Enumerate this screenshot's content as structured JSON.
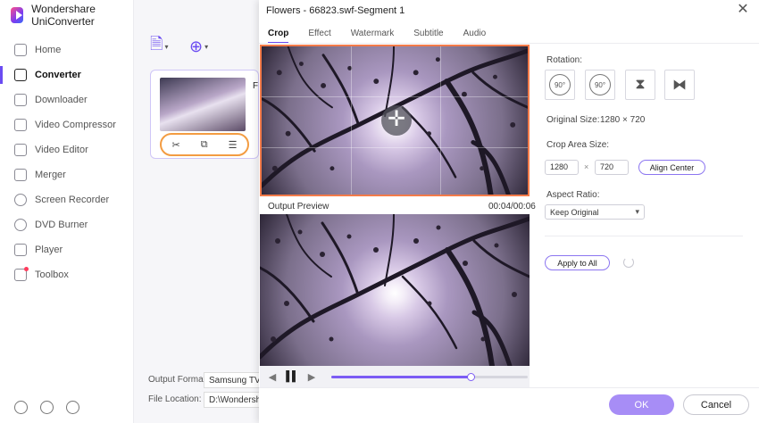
{
  "app": {
    "name": "Wondershare UniConverter"
  },
  "sidebar": {
    "items": [
      {
        "label": "Home",
        "icon": "home-icon",
        "active": false
      },
      {
        "label": "Converter",
        "icon": "converter-icon",
        "active": true
      },
      {
        "label": "Downloader",
        "icon": "downloader-icon",
        "active": false
      },
      {
        "label": "Video Compressor",
        "icon": "compress-icon",
        "active": false
      },
      {
        "label": "Video Editor",
        "icon": "video-editor-icon",
        "active": false
      },
      {
        "label": "Merger",
        "icon": "merger-icon",
        "active": false
      },
      {
        "label": "Screen Recorder",
        "icon": "screen-recorder-icon",
        "active": false
      },
      {
        "label": "DVD Burner",
        "icon": "dvd-icon",
        "active": false
      },
      {
        "label": "Player",
        "icon": "player-icon",
        "active": false
      },
      {
        "label": "Toolbox",
        "icon": "toolbox-icon",
        "active": false
      }
    ]
  },
  "converter": {
    "output_format_label": "Output Format:",
    "output_format_value": "Samsung TV",
    "file_location_label": "File Location:",
    "file_location_value": "D:\\Wondershare",
    "file_name_partial": "F"
  },
  "dialog": {
    "title": "Flowers - 66823.swf-Segment 1",
    "tabs": [
      {
        "label": "Crop",
        "active": true
      },
      {
        "label": "Effect",
        "active": false
      },
      {
        "label": "Watermark",
        "active": false
      },
      {
        "label": "Subtitle",
        "active": false
      },
      {
        "label": "Audio",
        "active": false
      }
    ],
    "preview": {
      "label": "Output Preview",
      "time": "00:04/00:06",
      "progress": 0.71
    },
    "settings": {
      "rotation_label": "Rotation:",
      "rotate_left_text": "90°",
      "rotate_right_text": "90°",
      "original_size_label": "Original Size:",
      "original_size_value": "1280 × 720",
      "crop_area_label": "Crop Area Size:",
      "crop_width": "1280",
      "crop_times": "×",
      "crop_height": "720",
      "align_center_label": "Align Center",
      "aspect_ratio_label": "Aspect Ratio:",
      "aspect_ratio_value": "Keep Original",
      "apply_all_label": "Apply to All"
    },
    "ok_label": "OK",
    "cancel_label": "Cancel"
  },
  "colors": {
    "accent": "#6b4cf2",
    "crop_border": "#f37b4a",
    "ok_button": "#a78df6"
  }
}
